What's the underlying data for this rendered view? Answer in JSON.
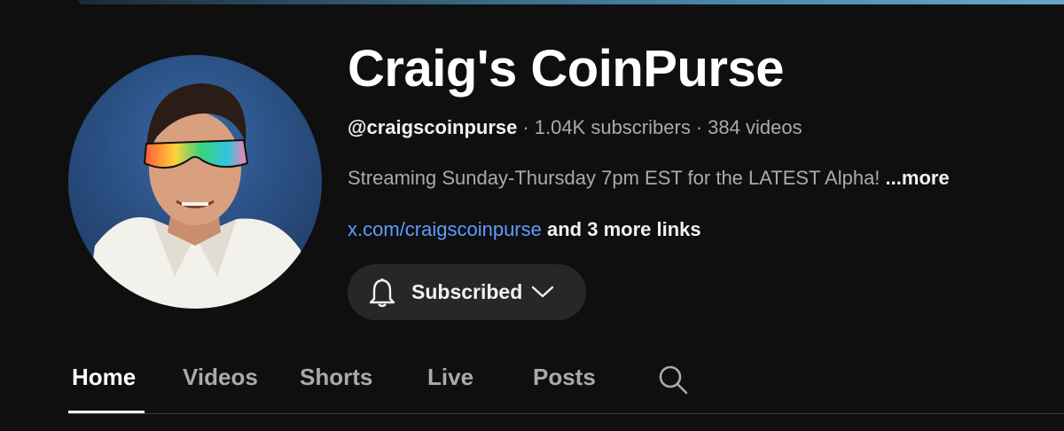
{
  "channel": {
    "name": "Craig's CoinPurse",
    "handle": "@craigscoinpurse",
    "subscribers": "1.04K subscribers",
    "videos": "384 videos",
    "separator": "·",
    "description": "Streaming Sunday-Thursday 7pm EST for the LATEST Alpha!",
    "description_more": "...more",
    "link": "x.com/craigscoinpurse",
    "more_links": "and 3 more links",
    "subscribe_label": "Subscribed"
  },
  "tabs": [
    {
      "label": "Home",
      "active": true
    },
    {
      "label": "Videos",
      "active": false
    },
    {
      "label": "Shorts",
      "active": false
    },
    {
      "label": "Live",
      "active": false
    },
    {
      "label": "Posts",
      "active": false
    }
  ],
  "icons": {
    "subscribe_bell": "bell-icon",
    "subscribe_menu": "chevron-down-icon",
    "tab_search": "search-icon"
  },
  "colors": {
    "background": "#0f0f0f",
    "link": "#5e9bff",
    "button_bg": "#272727",
    "muted_text": "#aaaaaa"
  }
}
